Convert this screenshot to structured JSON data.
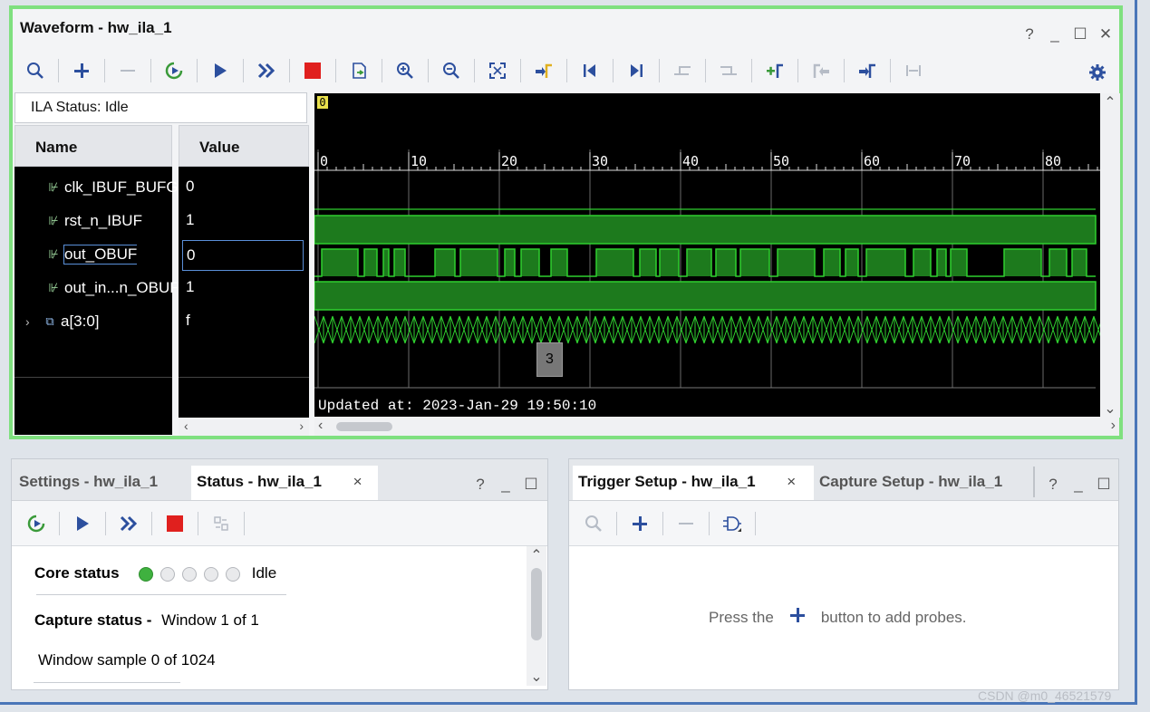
{
  "waveform": {
    "title": "Waveform - hw_ila_1",
    "ila_status": "ILA Status:  Idle",
    "name_header": "Name",
    "value_header": "Value",
    "signals": [
      {
        "name": "clk_IBUF_BUFG",
        "value": "0",
        "icon": "probe-icon"
      },
      {
        "name": "rst_n_IBUF",
        "value": "1",
        "icon": "probe-icon"
      },
      {
        "name": "out_OBUF",
        "value": "0",
        "icon": "probe-icon"
      },
      {
        "name": "out_in...n_OBUF",
        "value": "1",
        "icon": "probe-icon"
      },
      {
        "name": "a[3:0]",
        "value": "f",
        "icon": "bus-icon"
      }
    ],
    "ruler_labels": [
      "0",
      "10",
      "20",
      "30",
      "40",
      "50",
      "60",
      "70",
      "80"
    ],
    "marker_label": "0",
    "cursor_value": "3",
    "updated_text": "Updated at: 2023-Jan-29 19:50:10",
    "toolbar_icons": [
      "search-icon",
      "add-icon",
      "remove-icon",
      "run-trigger-icon",
      "run-icon",
      "run-immediate-icon",
      "stop-icon",
      "export-icon",
      "zoom-in-icon",
      "zoom-out-icon",
      "zoom-fit-icon",
      "go-to-cursor-icon",
      "go-to-start-icon",
      "go-to-end-icon",
      "prev-transition-icon",
      "next-transition-icon",
      "add-marker-icon",
      "prev-marker-icon",
      "next-marker-icon",
      "swap-cursor-icon",
      "settings-icon"
    ]
  },
  "status_panel": {
    "tabs": [
      "Settings - hw_ila_1",
      "Status - hw_ila_1"
    ],
    "close": "×",
    "core_status_label": "Core status",
    "core_status_value": "Idle",
    "capture_status_label": "Capture status -",
    "capture_status_value": "Window 1 of 1",
    "window_sample": "Window sample 0 of 1024"
  },
  "trigger_panel": {
    "tabs": [
      "Trigger Setup - hw_ila_1",
      "Capture Setup - hw_ila_1"
    ],
    "close": "×",
    "hint_before": "Press the",
    "hint_after": "button to add probes."
  },
  "window_controls": {
    "help": "?",
    "minimize": "_",
    "maximize": "☐",
    "close": "✕"
  },
  "watermark": "CSDN @m0_46521579",
  "colors": {
    "wave_green": "#2fd02f",
    "border_green": "#7fe07f",
    "accent_blue": "#2c4f9e",
    "stop_red": "#e0201e"
  }
}
